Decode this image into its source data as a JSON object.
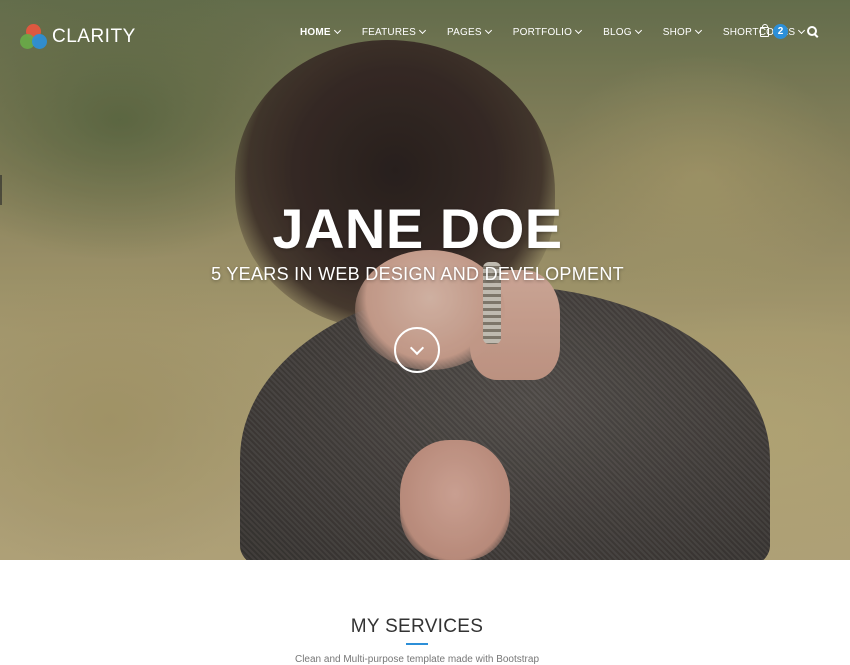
{
  "brand": {
    "name": "CLARITY",
    "accent": "#2c8fd8"
  },
  "nav": {
    "items": [
      {
        "label": "HOME",
        "active": true
      },
      {
        "label": "FEATURES"
      },
      {
        "label": "PAGES"
      },
      {
        "label": "PORTFOLIO"
      },
      {
        "label": "BLOG"
      },
      {
        "label": "SHOP"
      },
      {
        "label": "SHORTCODES"
      }
    ],
    "cart_count": "2",
    "icons": {
      "cart": "shopping-bag-icon",
      "search": "search-icon",
      "dropdown": "chevron-down-icon"
    }
  },
  "hero": {
    "title": "JANE DOE",
    "subtitle": "5 YEARS IN WEB DESIGN AND DEVELOPMENT",
    "scroll_icon": "chevron-down-circle-icon"
  },
  "services": {
    "title": "MY SERVICES",
    "description": "Clean and Multi-purpose template made with Bootstrap"
  }
}
